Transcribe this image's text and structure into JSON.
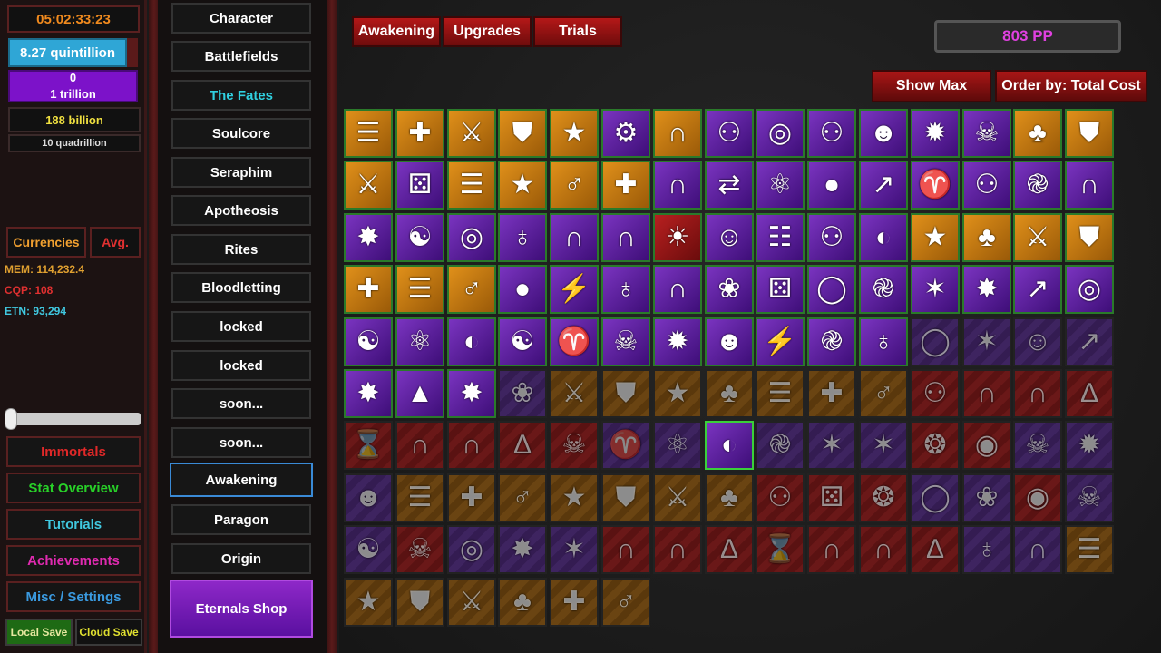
{
  "left": {
    "timer": "05:02:33:23",
    "currency_1": "8.27 quintillion",
    "currency_2_top": "0",
    "currency_2_bottom": "1 trillion",
    "currency_3": "188 billion",
    "currency_4": "10 quadrillion",
    "tab_currencies": "Currencies",
    "tab_avg": "Avg.",
    "stats": [
      {
        "label": "MEM: 114,232.4",
        "color": "#e0a030"
      },
      {
        "label": "CQP: 108",
        "color": "#e03030"
      },
      {
        "label": "ETN: 93,294",
        "color": "#40c8e0"
      }
    ],
    "menu": [
      {
        "label": "Immortals",
        "color": "#e02828"
      },
      {
        "label": "Stat Overview",
        "color": "#28d028"
      },
      {
        "label": "Tutorials",
        "color": "#40c8e0"
      },
      {
        "label": "Achievements",
        "color": "#e02ab0"
      },
      {
        "label": "Misc / Settings",
        "color": "#3a9ae0"
      }
    ],
    "local_save": "Local Save",
    "cloud_save": "Cloud Save"
  },
  "nav": {
    "items": [
      {
        "label": "Character",
        "color": "#ffffff"
      },
      {
        "label": "Battlefields",
        "color": "#ffffff"
      },
      {
        "label": "The Fates",
        "color": "#30d0e0"
      },
      {
        "label": "Soulcore",
        "color": "#ffffff"
      },
      {
        "label": "Seraphim",
        "color": "#ffffff"
      },
      {
        "label": "Apotheosis",
        "color": "#ffffff"
      },
      {
        "label": "Rites",
        "color": "#ffffff"
      },
      {
        "label": "Bloodletting",
        "color": "#ffffff"
      },
      {
        "label": "locked",
        "color": "#ffffff"
      },
      {
        "label": "locked",
        "color": "#ffffff"
      },
      {
        "label": "soon...",
        "color": "#ffffff"
      },
      {
        "label": "soon...",
        "color": "#ffffff"
      },
      {
        "label": "Awakening",
        "color": "#ffffff"
      },
      {
        "label": "Paragon",
        "color": "#ffffff"
      },
      {
        "label": "Origin",
        "color": "#ffffff"
      }
    ],
    "selected_index": 12,
    "eternals_shop": "Eternals Shop"
  },
  "header": {
    "tabs": [
      "Awakening",
      "Upgrades",
      "Trials"
    ],
    "pp": "803 PP",
    "show_max": "Show Max",
    "order_by": "Order by: Total Cost"
  },
  "colors": {
    "gold": "#c8780c",
    "purple": "#5a1e9a",
    "red": "#8a1a1a"
  },
  "grid": {
    "rows": [
      [
        "G:wings-icon",
        "G:heart-cross-icon",
        "G:crossed-swords-icon",
        "G:shield-icon",
        "G:star-shield-icon",
        "P:gear-orb-icon",
        "G:helmet-icon",
        "P:figure-icon",
        "P:keyhole-icon",
        "P:figure-icon",
        "P:skull-head-icon",
        "P:burst-skull-icon",
        "P:skull-icon",
        "G:clover-icon",
        "G:shield-icon"
      ],
      [
        "G:crossed-swords-icon",
        "P:dice-icon",
        "G:wings-icon",
        "G:star-shield-icon",
        "G:person-plus-icon",
        "G:heart-cross-icon",
        "P:helmet-icon",
        "P:arrows-icon",
        "P:triskele-icon",
        "P:orb-icon",
        "P:chart-up-icon",
        "P:devil-icon",
        "P:figure-icon",
        "P:spiral-icon",
        "P:helmet-icon"
      ],
      [
        "P:tree-burst-icon",
        "P:swirl-icon",
        "P:keyhole-icon",
        "P:planet-icon",
        "P:helmet-icon",
        "P:helmet-icon",
        "R:sun-wheel-icon",
        "P:grin-icon",
        "P:tree-chart-icon",
        "P:figure-icon",
        "P:eye-egg-icon",
        "G:star-shield-icon",
        "G:clover-icon",
        "G:crossed-swords-icon",
        "G:shield-icon"
      ],
      [
        "G:heart-cross-icon",
        "G:wings-icon",
        "G:person-plus-icon",
        "P:orb-icon",
        "P:lightning-icon",
        "P:planet-icon",
        "P:helmet-icon",
        "P:thorn-icon",
        "P:dice-icon",
        "P:ring-icon",
        "P:spiral-icon",
        "P:star-icon",
        "P:tree-burst-icon",
        "P:chart-up-icon",
        "P:keyhole-icon"
      ],
      [
        "P:swirl-icon",
        "P:triskele-icon",
        "P:eye-egg-icon",
        "P:yin-icon",
        "P:devil-icon",
        "P:skull-icon",
        "P:burst-skull-icon",
        "P:skull-head-icon",
        "P:lightning-icon",
        "P:spiral-icon",
        "P:planet-icon",
        "p:ring-icon",
        "p:star-icon",
        "p:grin-icon",
        "p:chart-up-icon"
      ],
      [
        "P:tree-burst-icon",
        "P:pyramid-icon",
        "P:tree-burst-icon",
        "p:thorn-icon",
        "g:crossed-swords-icon",
        "g:shield-icon",
        "g:star-shield-icon",
        "g:clover-icon",
        "g:wings-icon",
        "g:heart-cross-icon",
        "g:person-plus-icon",
        "r:figure-icon",
        "r:hood-icon",
        "r:helmet-icon",
        "r:robe-icon"
      ],
      [
        "r:hourglass-icon",
        "r:hood-icon",
        "r:helmet-icon",
        "r:robe-icon",
        "r:drip-skull-icon",
        "p:devil-icon",
        "p:triskele-icon",
        "S:eye-egg-icon",
        "p:spiral-icon",
        "p:star-icon",
        "p:star-icon",
        "r:web-icon",
        "r:target-icon",
        "p:skull-icon",
        "p:burst-skull-icon"
      ],
      [
        "p:skull-head-icon",
        "g:wings-icon",
        "g:heart-cross-icon",
        "g:person-plus-icon",
        "g:star-shield-icon",
        "g:shield-icon",
        "g:crossed-swords-icon",
        "g:clover-icon",
        "r:figure-icon",
        "r:dice-icon",
        "r:web-icon",
        "p:ring-icon",
        "p:thorn-icon",
        "r:target-icon",
        "p:skull-icon"
      ],
      [
        "p:swirl-icon",
        "r:drip-skull-icon",
        "p:keyhole-icon",
        "p:tree-burst-icon",
        "p:star-icon",
        "r:hood-icon",
        "r:helmet-icon",
        "r:robe-icon",
        "r:hourglass-icon",
        "r:hood-icon",
        "r:helmet-icon",
        "r:robe-icon",
        "p:planet-icon",
        "p:helmet-icon",
        "g:wings-icon"
      ],
      [
        "g:star-shield-icon",
        "g:shield-icon",
        "g:crossed-swords-icon",
        "g:clover-icon",
        "g:heart-cross-icon",
        "g:person-plus-icon"
      ]
    ]
  }
}
